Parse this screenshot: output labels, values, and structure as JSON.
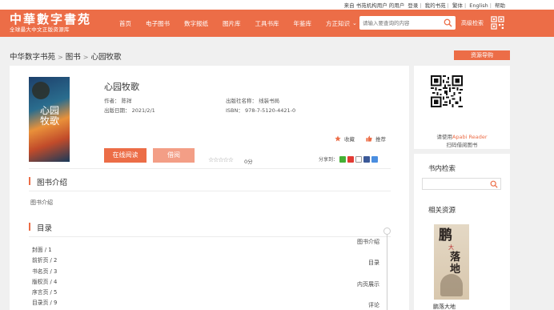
{
  "topbar": {
    "greeting": "来自 书苑机构用户 的用户",
    "links": [
      "登录",
      "我的书苑",
      "繁体",
      "English",
      "帮助"
    ]
  },
  "header": {
    "logo_title": "中華數字書苑",
    "logo_subtitle": "全球最大中文正版资源库",
    "nav": [
      "首页",
      "电子图书",
      "数字报纸",
      "图片库",
      "工具书库",
      "年鉴库",
      "方正知识"
    ],
    "search_placeholder": "请输入要查询的内容",
    "advanced_search": "高级检索"
  },
  "breadcrumb": [
    "中华数字书苑",
    "图书",
    "心园牧歌"
  ],
  "resource_button": "资源导购",
  "book": {
    "title": "心园牧歌",
    "cover_text": "心园牧歌",
    "author_label": "作者：",
    "author": "陈祥",
    "publisher_label": "出版社名称：",
    "publisher": "线装书局",
    "date_label": "出版日期：",
    "date": "2021/2/1",
    "isbn_label": "ISBN：",
    "isbn": "978-7-5120-4421-0",
    "collect": "收藏",
    "recommend": "推荐",
    "read_online": "在线阅读",
    "borrow": "借阅",
    "stars": "☆☆☆☆☆",
    "score": "0分",
    "share_label": "分享到："
  },
  "intro": {
    "heading": "图书介绍",
    "text": "图书介绍"
  },
  "toc": {
    "heading": "目录",
    "items": [
      "封面 / 1",
      "前折页 / 2",
      "书名页 / 3",
      "版权页 / 4",
      "序言页 / 5",
      "目录页 / 9"
    ]
  },
  "sidenav": [
    "图书介绍",
    "目录",
    "内页展示",
    "评论"
  ],
  "qr": {
    "line1_prefix": "请使用",
    "line1_app": "Apabi Reader",
    "line2": "扫码借阅图书"
  },
  "in_book_search": {
    "heading": "书内检索",
    "placeholder": ""
  },
  "related": {
    "heading": "相关资源",
    "cover_big": "鹏",
    "cover_small": "大",
    "cover_side": "落地",
    "title": "鹏落大地"
  },
  "colors": {
    "accent": "#ec6d47",
    "accent_light": "#f39e86",
    "page_bg": "#f0f0f0"
  }
}
